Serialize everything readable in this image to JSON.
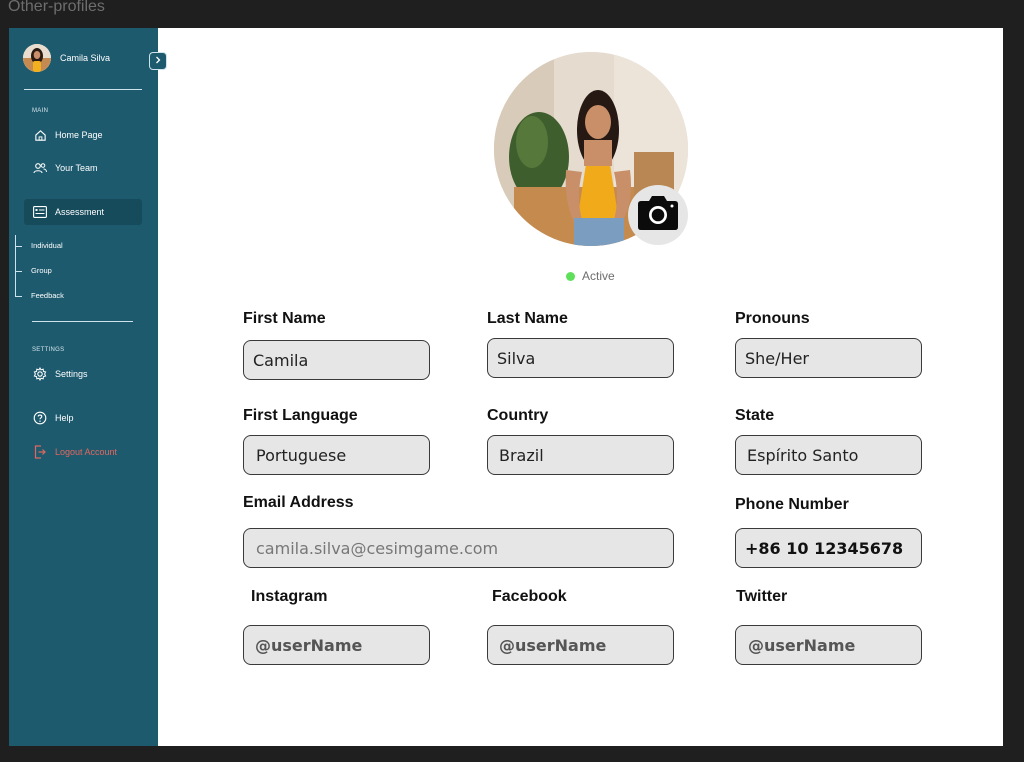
{
  "frame_title": "Other-profiles",
  "sidebar": {
    "user_name": "Camila Silva",
    "collapse_icon": "chevron-right-icon",
    "main_label": "MAIN",
    "items": [
      {
        "label": "Home Page",
        "icon": "home-icon"
      },
      {
        "label": "Your Team",
        "icon": "team-icon"
      },
      {
        "label": "Assessment",
        "icon": "assessment-icon"
      }
    ],
    "sub_items": [
      "Individual",
      "Group",
      "Feedback"
    ],
    "settings_label": "SETTINGS",
    "settings_items": [
      {
        "label": "Settings",
        "icon": "gear-icon"
      },
      {
        "label": "Help",
        "icon": "help-icon"
      },
      {
        "label": "Logout Account",
        "icon": "logout-icon"
      }
    ]
  },
  "profile": {
    "status": "Active",
    "status_color": "#5ee05a",
    "camera_icon": "camera-icon"
  },
  "form": {
    "first_name": {
      "label": "First Name",
      "value": "Camila"
    },
    "last_name": {
      "label": "Last Name",
      "value": "Silva"
    },
    "pronouns": {
      "label": "Pronouns",
      "value": "She/Her"
    },
    "first_language": {
      "label": "First Language",
      "value": "Portuguese"
    },
    "country": {
      "label": "Country",
      "value": "Brazil"
    },
    "state": {
      "label": "State",
      "value": "Espírito Santo"
    },
    "email": {
      "label": "Email Address",
      "placeholder": "camila.silva@cesimgame.com"
    },
    "phone": {
      "label": "Phone Number",
      "value": "+86 10 12345678"
    },
    "instagram": {
      "label": "Instagram",
      "placeholder": "@userName"
    },
    "facebook": {
      "label": "Facebook",
      "placeholder": "@userName"
    },
    "twitter": {
      "label": "Twitter",
      "placeholder": "@userName"
    }
  },
  "colors": {
    "sidebar_bg": "#1d5a6e",
    "logout": "#e2685f",
    "field_bg": "#e6e6e6"
  }
}
